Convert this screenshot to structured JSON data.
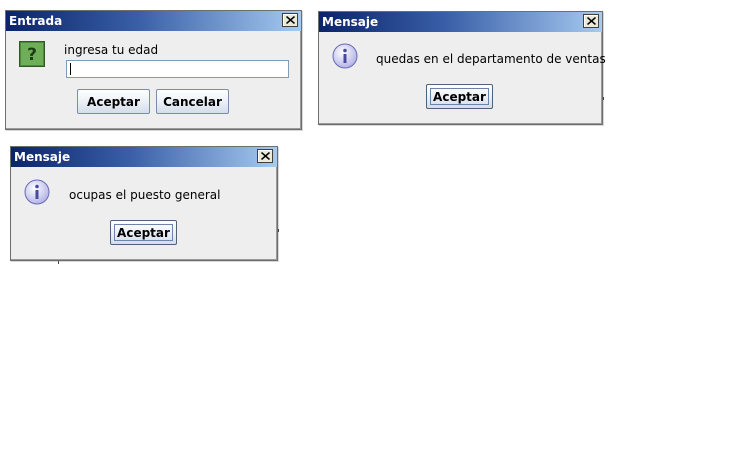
{
  "input_dialog": {
    "title": "Entrada",
    "icon": "question-icon",
    "prompt": "ingresa tu edad",
    "input_value": "",
    "accept_label": "Aceptar",
    "cancel_label": "Cancelar"
  },
  "message_dialog_department": {
    "title": "Mensaje",
    "icon": "information-icon",
    "message": "quedas en el departamento de ventas",
    "accept_label": "Aceptar"
  },
  "message_dialog_position": {
    "title": "Mensaje",
    "icon": "information-icon",
    "message": "ocupas el puesto general",
    "accept_label": "Aceptar"
  },
  "colors": {
    "title_gradient_start": "#0a246a",
    "title_gradient_end": "#a6caf0",
    "dialog_background": "#eeeeee",
    "question_icon_green": "#4f8a3c",
    "info_icon_lavender": "#c8c8f0"
  }
}
